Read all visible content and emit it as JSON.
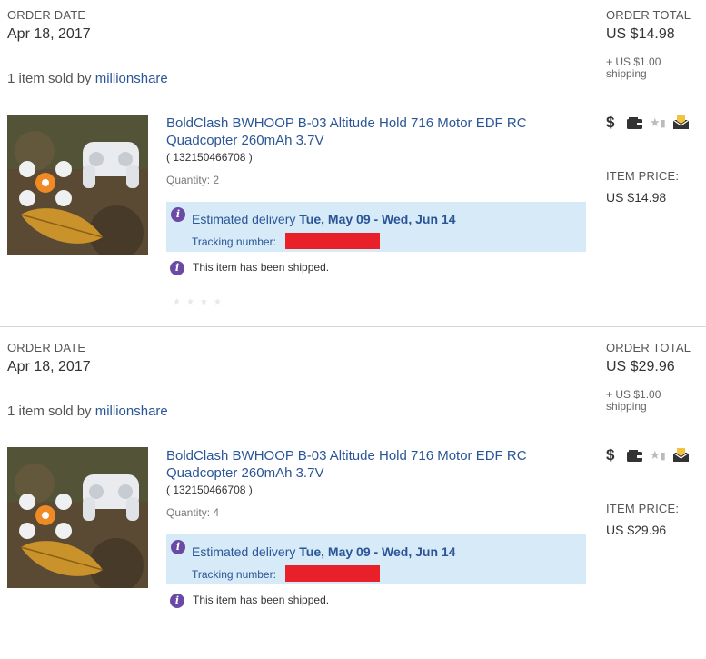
{
  "orders": [
    {
      "order_date_label": "ORDER DATE",
      "order_date": "Apr 18, 2017",
      "sold_prefix": "1 item sold by ",
      "seller": "millionshare",
      "item_title": "BoldClash BWHOOP B-03 Altitude Hold 716 Motor EDF RC Quadcopter 260mAh 3.7V",
      "item_id": "( 132150466708 )",
      "quantity": "Quantity: 2",
      "est_label": "Estimated delivery ",
      "est_dates": "Tue, May 09 - Wed, Jun 14",
      "tracking_label": "Tracking number:",
      "shipped_text": "This item has been shipped.",
      "order_total_label": "ORDER TOTAL",
      "order_total": "US $14.98",
      "shipping_line1": "+ US $1.00",
      "shipping_line2": "shipping",
      "item_price_label": "ITEM PRICE:",
      "item_price": "US $14.98"
    },
    {
      "order_date_label": "ORDER DATE",
      "order_date": "Apr 18, 2017",
      "sold_prefix": "1 item sold by ",
      "seller": "millionshare",
      "item_title": "BoldClash BWHOOP B-03 Altitude Hold 716 Motor EDF RC Quadcopter 260mAh 3.7V",
      "item_id": "( 132150466708 )",
      "quantity": "Quantity: 4",
      "est_label": "Estimated delivery ",
      "est_dates": "Tue, May 09 - Wed, Jun 14",
      "tracking_label": "Tracking number:",
      "shipped_text": "This item has been shipped.",
      "order_total_label": "ORDER TOTAL",
      "order_total": "US $29.96",
      "shipping_line1": "+ US $1.00",
      "shipping_line2": "shipping",
      "item_price_label": "ITEM PRICE:",
      "item_price": "US $29.96"
    }
  ],
  "icons": {
    "dollar": "dollar-icon",
    "payment": "wallet-icon",
    "feedback": "leave-feedback-icon",
    "message": "contact-seller-mail-icon"
  },
  "colors": {
    "link": "#2a5597",
    "delivery_bg": "#d6eaf8",
    "info_icon": "#6b4aa5",
    "redaction": "#e8202a"
  }
}
